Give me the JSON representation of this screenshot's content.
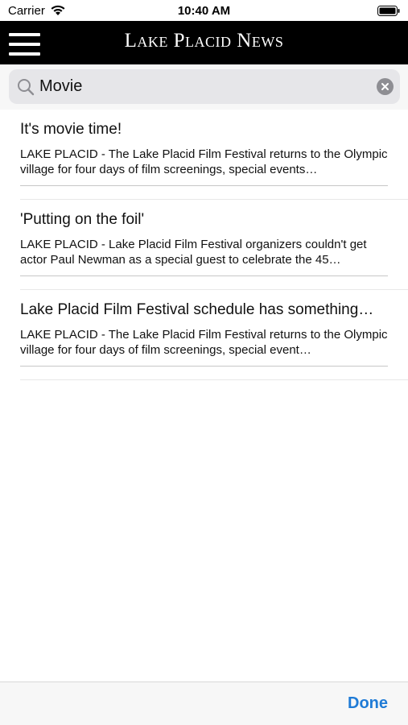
{
  "status_bar": {
    "carrier": "Carrier",
    "time": "10:40 AM",
    "wifi_icon": "wifi-icon",
    "battery_icon": "battery-icon"
  },
  "header": {
    "title": "Lake Placid News",
    "menu_icon": "hamburger-menu-icon",
    "background_color": "#000000"
  },
  "search": {
    "value": "Movie",
    "search_icon": "magnifier-icon",
    "clear_icon": "clear-circle-icon"
  },
  "results": [
    {
      "title": "It's movie time!",
      "snippet": "LAKE PLACID - The Lake Placid Film Festival returns to the Olympic village for four days of film screenings, special events…"
    },
    {
      "title": "'Putting on the foil'",
      "snippet": "LAKE PLACID - Lake Placid Film Festival organizers couldn't get actor Paul Newman as a special guest to celebrate the 45…"
    },
    {
      "title": "Lake Placid Film Festival schedule has something…",
      "snippet": "LAKE PLACID - The Lake Placid Film Festival returns to the Olympic village for four days of film screenings, special event…"
    }
  ],
  "toolbar": {
    "done_label": "Done",
    "accent_color": "#1f7bd6"
  }
}
